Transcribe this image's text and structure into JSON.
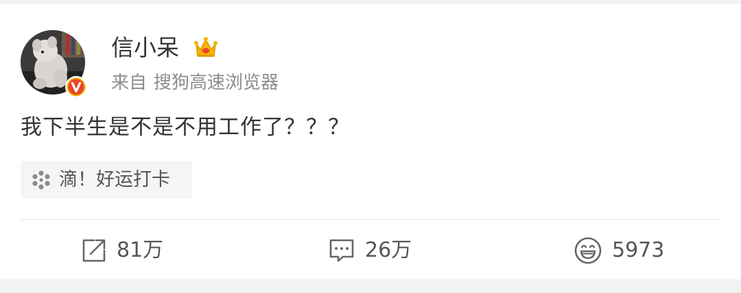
{
  "post": {
    "author": {
      "name": "信小呆",
      "avatar_icon": "avatar-plush-toy",
      "verified_icon": "verified-v-badge",
      "member_icon": "crown-icon"
    },
    "source": {
      "prefix": "来自",
      "name": "搜狗高速浏览器"
    },
    "text": "我下半生是不是不用工作了？？？",
    "topic": {
      "icon": "pinwheel-icon",
      "label": "滴！好运打卡"
    },
    "actions": {
      "repost": {
        "icon": "repost-icon",
        "count": "81万"
      },
      "comment": {
        "icon": "comment-icon",
        "count": "26万"
      },
      "like": {
        "icon": "laugh-icon",
        "count": "5973"
      }
    }
  },
  "colors": {
    "text_primary": "#333333",
    "text_secondary": "#8c8c8c",
    "verified_badge": "#e8452a",
    "crown": "#f5b400",
    "divider": "#e6e6e6",
    "background_gray": "#f2f2f2"
  }
}
